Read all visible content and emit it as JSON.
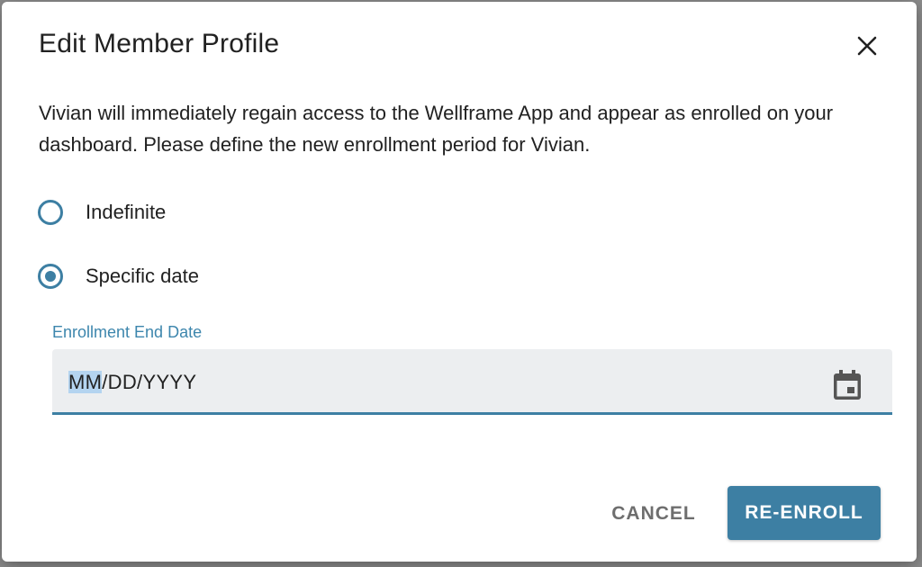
{
  "dialog": {
    "title": "Edit Member Profile",
    "description": "Vivian will immediately regain access to the Wellframe App and appear as enrolled on your dashboard. Please define the new enrollment period for Vivian.",
    "close_icon": "close-icon"
  },
  "enrollment_options": [
    {
      "label": "Indefinite",
      "checked": false
    },
    {
      "label": "Specific date",
      "checked": true
    }
  ],
  "end_date": {
    "label": "Enrollment End Date",
    "placeholder_selected": "MM",
    "placeholder_rest": "/DD/YYYY",
    "icon": "calendar-icon"
  },
  "actions": {
    "cancel_label": "CANCEL",
    "reenroll_label": "RE-ENROLL"
  },
  "colors": {
    "accent": "#3d7fa3",
    "label_accent": "#3d86ad",
    "field_bg": "#eceef0",
    "text": "#212121"
  }
}
